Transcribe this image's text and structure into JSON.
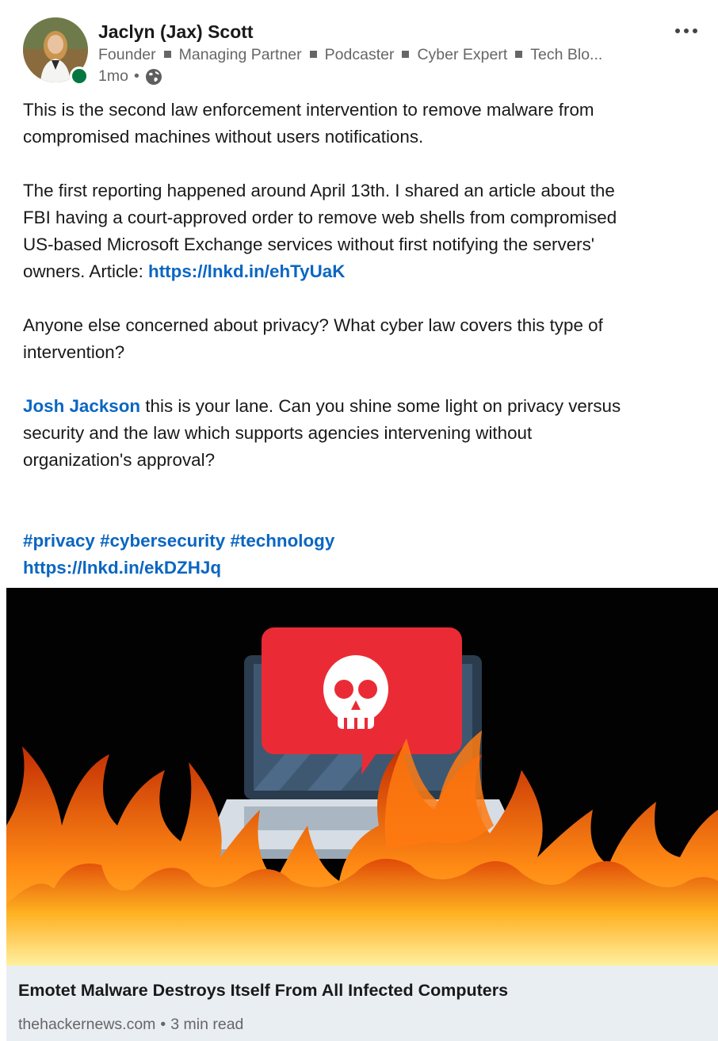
{
  "author": {
    "name": "Jaclyn (Jax) Scott",
    "headline": [
      "Founder",
      "Managing Partner",
      "Podcaster",
      "Cyber Expert",
      "Tech Blo..."
    ],
    "time": "1mo",
    "separator": "•",
    "visibility_icon": "globe-icon",
    "presence_color": "#057642"
  },
  "post": {
    "p1": [
      "This is the second law enforcement intervention to remove malware from",
      "compromised machines without users notifications."
    ],
    "p2": [
      "The first reporting happened around April 13th. I shared an article about the",
      "FBI having a court-approved order to remove web shells from compromised",
      "US-based Microsoft Exchange services without first notifying the servers'"
    ],
    "p2_last_prefix": "owners. Article: ",
    "p2_link": "https://lnkd.in/ehTyUaK",
    "p3": [
      "Anyone else concerned about privacy? What cyber law covers this type of",
      "intervention?"
    ],
    "mention": "Josh Jackson",
    "p4_first_rest": " this is your lane. Can you shine some light on privacy versus",
    "p4": [
      "security and the law which supports agencies intervening without",
      "organization's approval?"
    ],
    "hashtags": [
      "#privacy",
      "#cybersecurity",
      "#technology"
    ],
    "link2": "https://lnkd.in/ekDZHJq",
    "link_color": "#0a66c2"
  },
  "article": {
    "title": "Emotet Malware Destroys Itself From All Infected Computers",
    "source": "thehackernews.com",
    "separator": "•",
    "read_time": "3 min read",
    "image_icons": [
      "laptop-icon",
      "skull-icon",
      "fire-icon"
    ]
  }
}
